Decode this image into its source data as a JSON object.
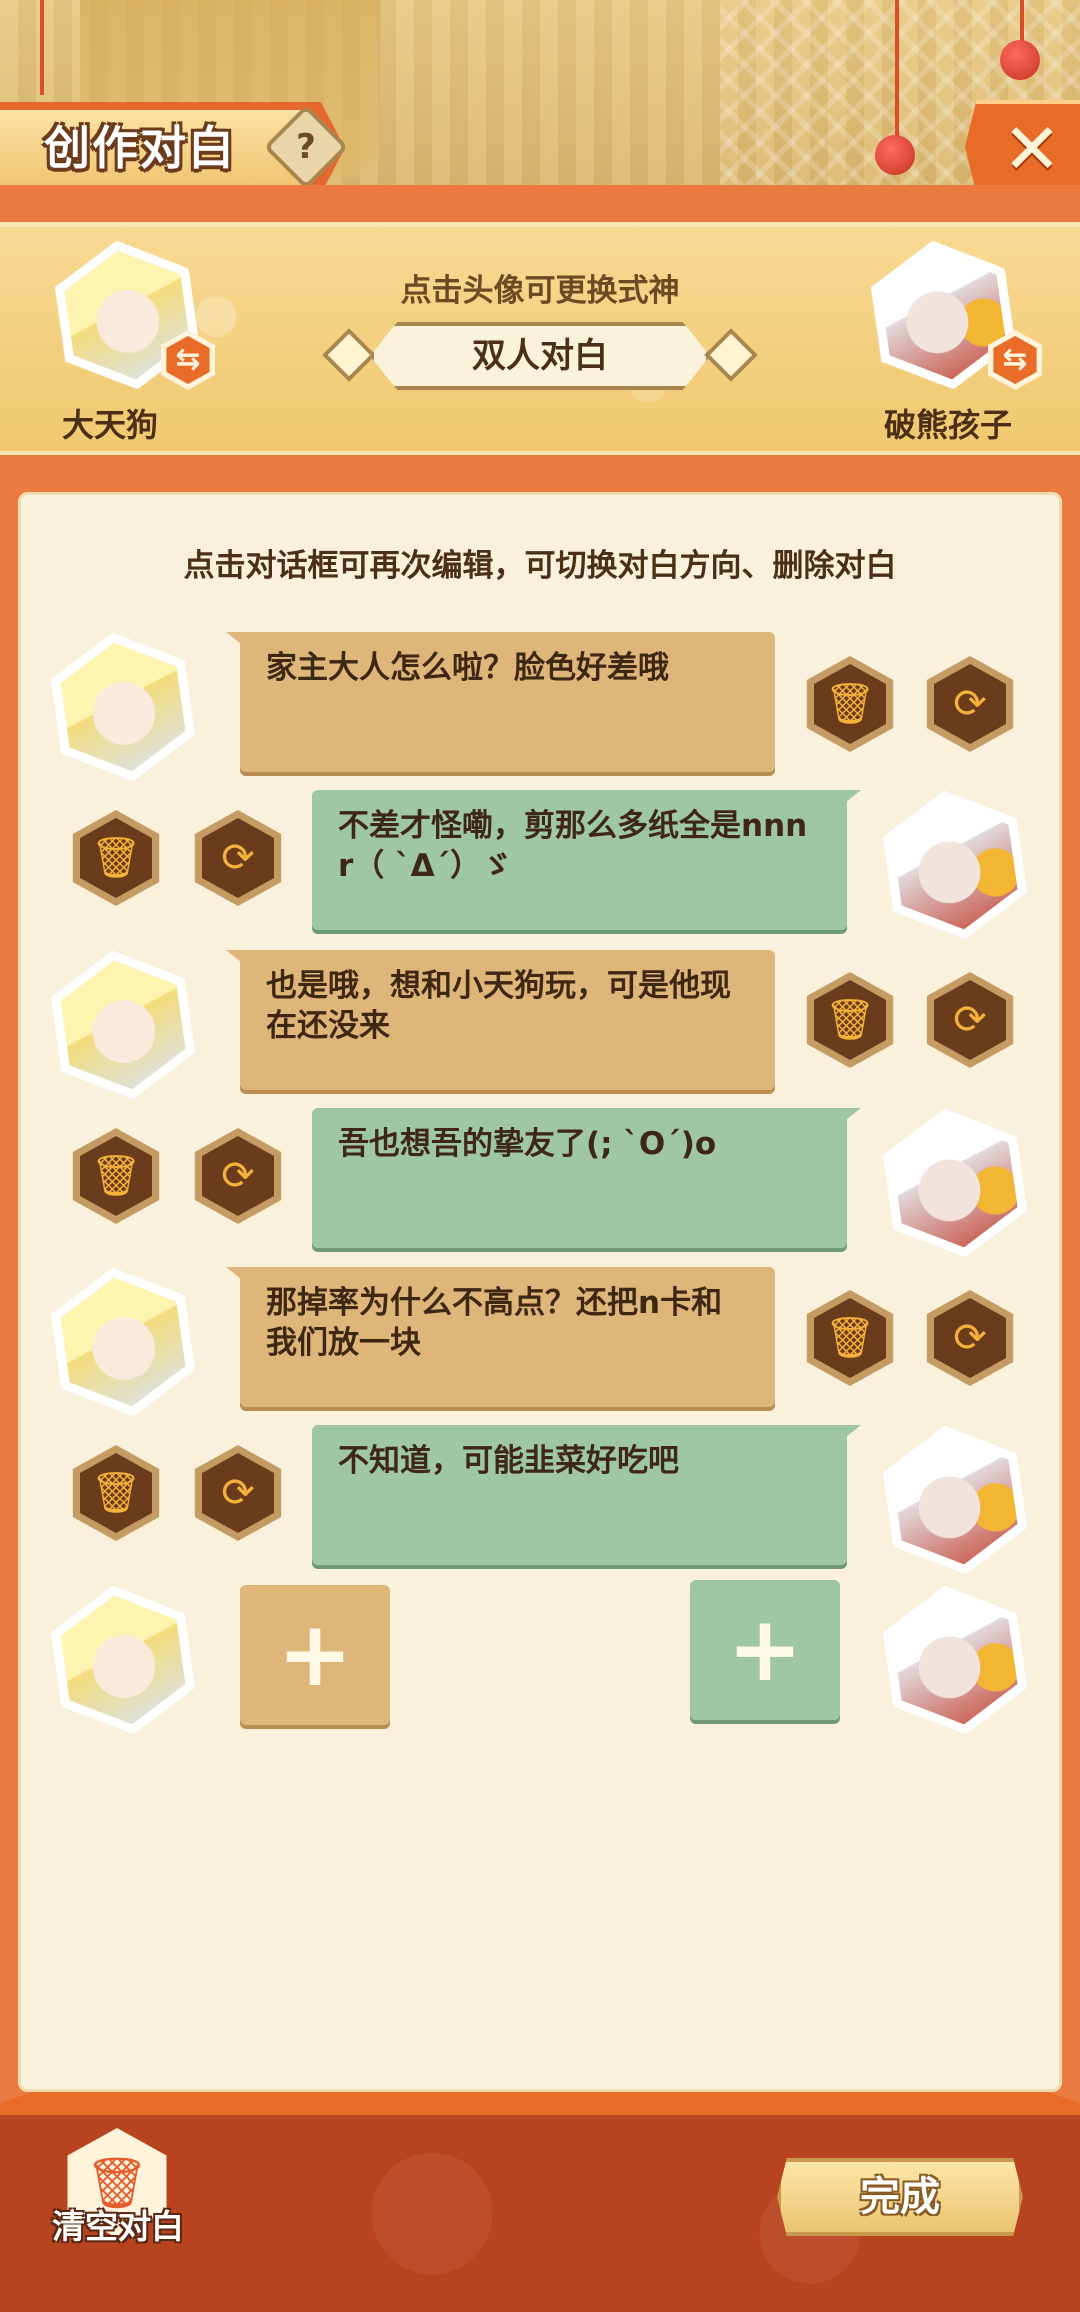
{
  "header": {
    "title": "创作对白",
    "help_label": "?",
    "close_label": "✕"
  },
  "selector": {
    "hint": "点击头像可更换式神",
    "mode": "双人对白",
    "left_character": "大天狗",
    "right_character": "破熊孩子",
    "swap_icon": "⇆"
  },
  "panel": {
    "hint": "点击对话框可再次编辑，可切换对白方向、删除对白"
  },
  "dialogues": [
    {
      "side": "left",
      "text": "家主大人怎么啦？脸色好差哦"
    },
    {
      "side": "right",
      "text": "不差才怪嘞，剪那么多纸全是nnnr（ `Δ´）ゞ"
    },
    {
      "side": "left",
      "text": "也是哦，想和小天狗玩，可是他现在还没来"
    },
    {
      "side": "right",
      "text": "吾也想吾的挚友了(; `O´)o"
    },
    {
      "side": "left",
      "text": "那掉率为什么不高点？还把n卡和我们放一块"
    },
    {
      "side": "right",
      "text": "不知道，可能韭菜好吃吧"
    }
  ],
  "add": {
    "left_label": "+",
    "right_label": "+"
  },
  "icons": {
    "delete": "🗑",
    "rotate": "⟳"
  },
  "footer": {
    "clear_label": "清空对白",
    "done_label": "完成"
  },
  "colors": {
    "accent_orange": "#ea7a3f",
    "left_bubble": "#dfb679",
    "right_bubble": "#9ec7a2",
    "panel_bg": "#faf1dc",
    "footer_bg": "#b8431f"
  }
}
